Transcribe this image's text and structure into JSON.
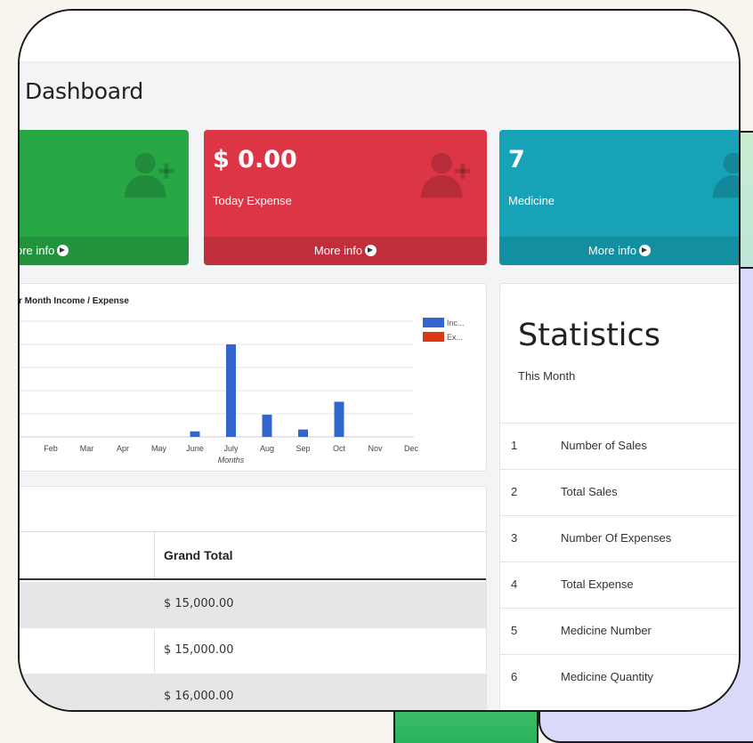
{
  "page": {
    "title": "Dashboard"
  },
  "cards": [
    {
      "value": "",
      "label": "",
      "footer": "ore info",
      "color": "#28a745",
      "icon": "add-user-icon"
    },
    {
      "value": "$ 0.00",
      "label": "Today Expense",
      "footer": "More info",
      "color": "#dc3545",
      "icon": "add-user-icon"
    },
    {
      "value": "7",
      "label": "Medicine",
      "footer": "More info",
      "color": "#17a2b8",
      "icon": "add-user-icon"
    }
  ],
  "chart_data": {
    "type": "bar",
    "title": "r Month Income / Expense",
    "xlabel": "Months",
    "ylabel": "",
    "categories": [
      "Feb",
      "Mar",
      "Apr",
      "May",
      "June",
      "July",
      "Aug",
      "Sep",
      "Oct",
      "Nov",
      "Dec"
    ],
    "series": [
      {
        "name": "Inc...",
        "color": "#3366cc",
        "values": [
          0,
          0,
          0,
          0,
          6,
          100,
          24,
          8,
          38,
          0,
          0
        ]
      },
      {
        "name": "Ex...",
        "color": "#dc3912",
        "values": [
          0,
          0,
          0,
          0,
          0,
          0,
          0,
          0,
          0,
          0,
          0
        ]
      }
    ],
    "ylim": [
      0,
      125
    ],
    "grid": true,
    "legend": "top-right"
  },
  "sales_table": {
    "header": "Grand Total",
    "rows": [
      "$ 15,000.00",
      "$ 15,000.00",
      "$ 16,000.00"
    ]
  },
  "statistics": {
    "title": "Statistics",
    "subtitle": "This Month",
    "rows": [
      {
        "num": "1",
        "label": "Number of Sales"
      },
      {
        "num": "2",
        "label": "Total Sales"
      },
      {
        "num": "3",
        "label": "Number Of Expenses"
      },
      {
        "num": "4",
        "label": "Total Expense"
      },
      {
        "num": "5",
        "label": "Medicine Number"
      },
      {
        "num": "6",
        "label": "Medicine Quantity"
      }
    ]
  }
}
